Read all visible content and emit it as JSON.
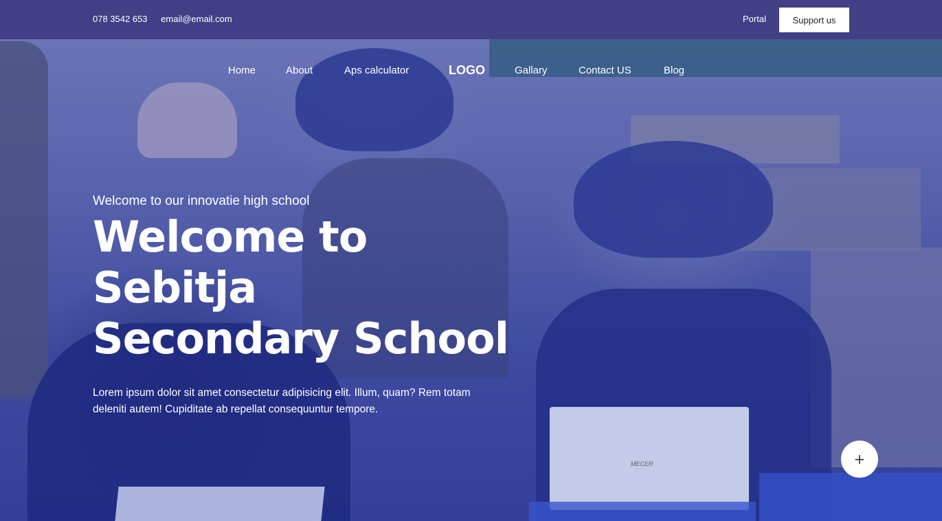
{
  "topbar": {
    "phone": "078 3542 653",
    "email": "email@email.com",
    "portal_label": "Portal",
    "support_label": "Support us",
    "background_color": "#423f86"
  },
  "nav": {
    "items": [
      {
        "label": "Home"
      },
      {
        "label": "About"
      },
      {
        "label": "Aps calculator"
      },
      {
        "label": "Gallary"
      },
      {
        "label": "Contact US"
      },
      {
        "label": "Blog"
      }
    ],
    "logo": "LOGO"
  },
  "hero": {
    "subtitle": "Welcome to our innovatie high school",
    "title_line1": "Welcome to Sebitja",
    "title_line2": "Secondary School",
    "description": "Lorem ipsum dolor sit amet consectetur adipisicing elit. Illum, quam? Rem totam deleniti autem! Cupiditate ab repellat consequuntur tempore.",
    "overlay_color": "#3a4a9e",
    "laptop_brand": "MECER"
  },
  "fab": {
    "icon": "plus-icon",
    "glyph": "+"
  }
}
